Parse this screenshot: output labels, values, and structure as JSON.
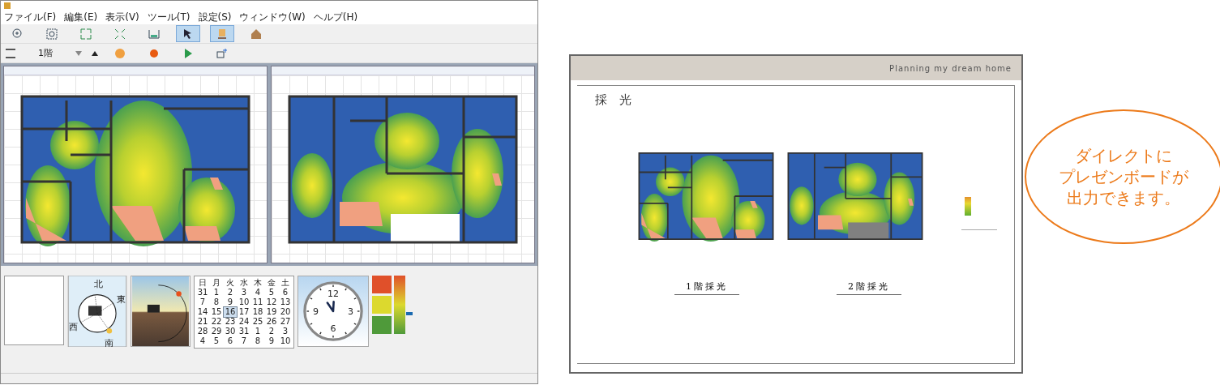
{
  "app": {
    "menu": [
      "ファイル(F)",
      "編集(E)",
      "表示(V)",
      "ツール(T)",
      "設定(S)",
      "ウィンドウ(W)",
      "ヘルプ(H)"
    ],
    "toolbar": [
      {
        "kind": "zoom-in",
        "selected": false
      },
      {
        "kind": "zoom-box",
        "selected": false
      },
      {
        "kind": "fit",
        "selected": false
      },
      {
        "kind": "shrink",
        "selected": false
      },
      {
        "kind": "frame",
        "selected": false
      },
      {
        "kind": "pointer",
        "selected": true
      },
      {
        "kind": "lamp",
        "selected": true
      },
      {
        "kind": "house",
        "selected": false
      }
    ],
    "floor": "1階",
    "tools": [
      {
        "kind": "orange-ball"
      },
      {
        "kind": "orange-dot"
      },
      {
        "kind": "play"
      },
      {
        "kind": "export"
      }
    ],
    "panes": [
      {
        "kind": "floor1"
      },
      {
        "kind": "floor2"
      }
    ],
    "compass": {
      "labels": [
        "北",
        "東",
        "西",
        "南"
      ]
    },
    "calendar": {
      "weekdays": [
        "日",
        "月",
        "火",
        "水",
        "木",
        "金",
        "土"
      ],
      "weeks": [
        [
          {
            "d": "31",
            "selected": false
          },
          {
            "d": "1",
            "selected": false
          },
          {
            "d": "2",
            "selected": false
          },
          {
            "d": "3",
            "selected": false
          },
          {
            "d": "4",
            "selected": false
          },
          {
            "d": "5",
            "selected": false
          },
          {
            "d": "6",
            "selected": false
          }
        ],
        [
          {
            "d": "7",
            "selected": false
          },
          {
            "d": "8",
            "selected": false
          },
          {
            "d": "9",
            "selected": false
          },
          {
            "d": "10",
            "selected": false
          },
          {
            "d": "11",
            "selected": false
          },
          {
            "d": "12",
            "selected": false
          },
          {
            "d": "13",
            "selected": false
          }
        ],
        [
          {
            "d": "14",
            "selected": false
          },
          {
            "d": "15",
            "selected": false
          },
          {
            "d": "16",
            "selected": true
          },
          {
            "d": "17",
            "selected": false
          },
          {
            "d": "18",
            "selected": false
          },
          {
            "d": "19",
            "selected": false
          },
          {
            "d": "20",
            "selected": false
          }
        ],
        [
          {
            "d": "21",
            "selected": false
          },
          {
            "d": "22",
            "selected": false
          },
          {
            "d": "23",
            "selected": false
          },
          {
            "d": "24",
            "selected": false
          },
          {
            "d": "25",
            "selected": false
          },
          {
            "d": "26",
            "selected": false
          },
          {
            "d": "27",
            "selected": false
          }
        ],
        [
          {
            "d": "28",
            "selected": false
          },
          {
            "d": "29",
            "selected": false
          },
          {
            "d": "30",
            "selected": false
          },
          {
            "d": "31",
            "selected": false
          },
          {
            "d": "1",
            "selected": false
          },
          {
            "d": "2",
            "selected": false
          },
          {
            "d": "3",
            "selected": false
          }
        ],
        [
          {
            "d": "4",
            "selected": false
          },
          {
            "d": "5",
            "selected": false
          },
          {
            "d": "6",
            "selected": false
          },
          {
            "d": "7",
            "selected": false
          },
          {
            "d": "8",
            "selected": false
          },
          {
            "d": "9",
            "selected": false
          },
          {
            "d": "10",
            "selected": false
          }
        ]
      ]
    },
    "clock": {
      "numbers": [
        "12",
        "3",
        "6",
        "9"
      ]
    },
    "light_meter": {
      "level": 0.35,
      "boxes": [
        {
          "color": "#e0502a"
        },
        {
          "color": "#dcd92e"
        },
        {
          "color": "#4f9a3a"
        }
      ]
    }
  },
  "board": {
    "tagline": "Planning my dream home",
    "heading": "採　光",
    "plans": [
      {
        "kind": "floor1"
      },
      {
        "kind": "floor2"
      }
    ],
    "captions": [
      "1階採光",
      "2階採光"
    ]
  },
  "callout": [
    "ダイレクトに",
    "プレゼンボードが",
    "出力できます。"
  ]
}
